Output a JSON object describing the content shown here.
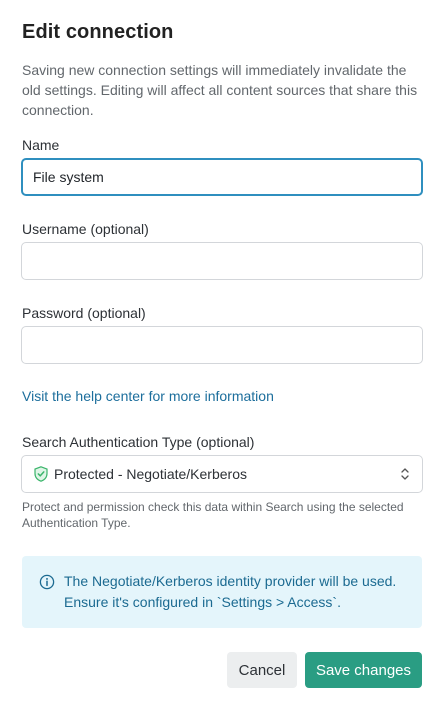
{
  "dialog": {
    "title": "Edit connection",
    "description": "Saving new connection settings will immediately invalidate the old settings. Editing will affect all content sources that share this connection."
  },
  "fields": {
    "name": {
      "label": "Name",
      "value": "File system"
    },
    "username": {
      "label": "Username (optional)",
      "value": ""
    },
    "password": {
      "label": "Password (optional)",
      "value": ""
    }
  },
  "help_link": "Visit the help center for more information",
  "auth": {
    "label": "Search Authentication Type (optional)",
    "selected": "Protected - Negotiate/Kerberos",
    "icon": "shield-check-icon",
    "hint": "Protect and permission check this data within Search using the selected Authentication Type."
  },
  "callout": {
    "icon": "info-icon",
    "message": "The Negotiate/Kerberos identity provider will be used. Ensure it's configured in `Settings > Access`."
  },
  "buttons": {
    "cancel": "Cancel",
    "save": "Save changes"
  },
  "colors": {
    "accent": "#2a9d83",
    "focus_border": "#2f8fbf",
    "link": "#1c6e9c",
    "callout_bg": "#e4f5fb",
    "shield_green": "#3bb56b"
  }
}
